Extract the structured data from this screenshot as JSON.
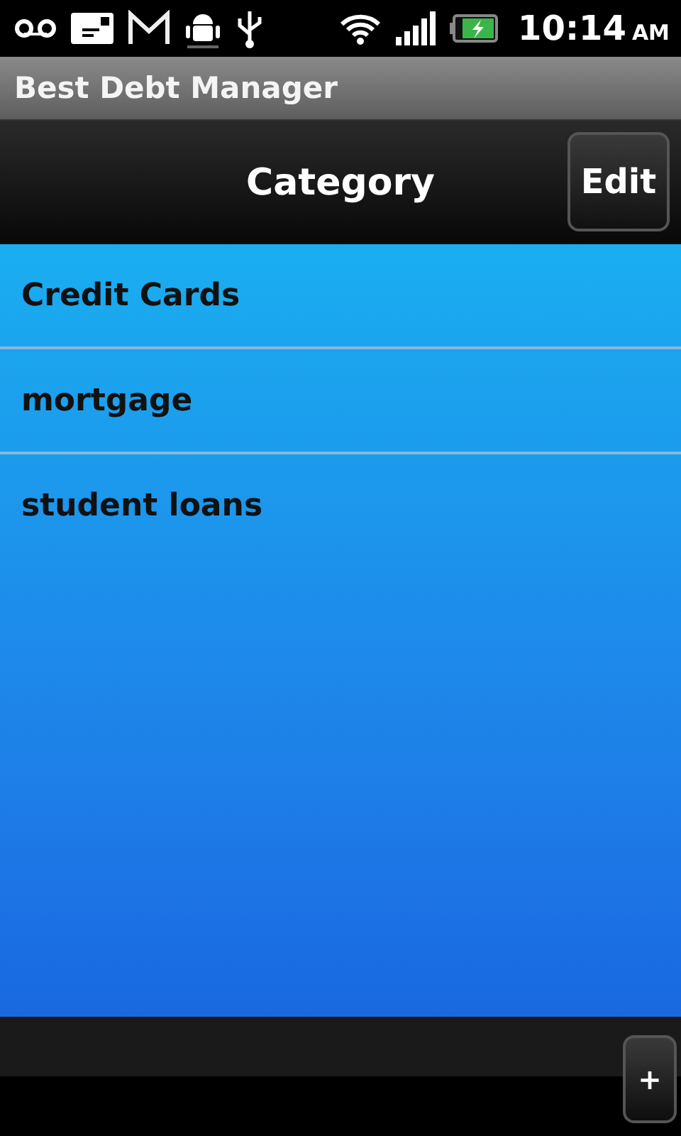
{
  "status_bar": {
    "time": "10:14",
    "meridiem": "AM"
  },
  "app_title": "Best Debt Manager",
  "nav_bar": {
    "title": "Category",
    "edit_button": "Edit"
  },
  "categories": [
    {
      "label": "Credit Cards"
    },
    {
      "label": "mortgage"
    },
    {
      "label": "student loans"
    }
  ],
  "bottom_bar": {
    "add_button": "+"
  }
}
